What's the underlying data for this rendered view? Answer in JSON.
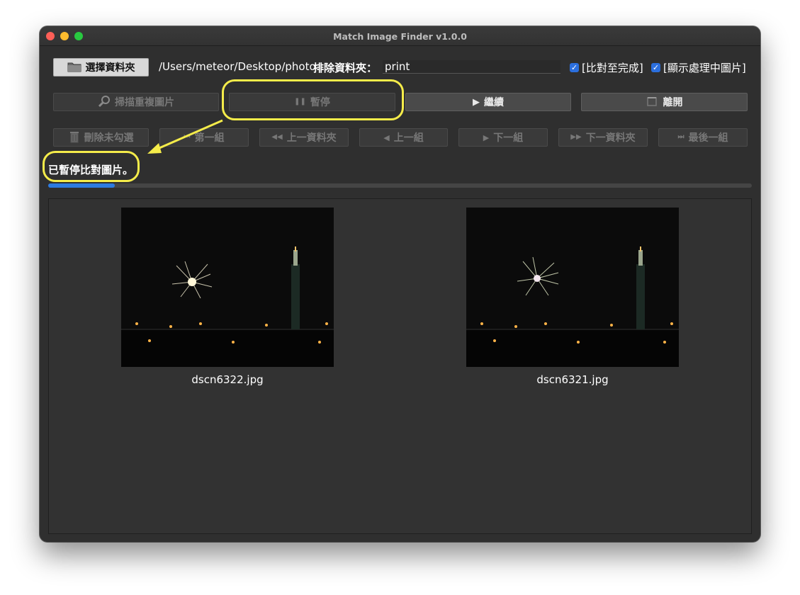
{
  "window": {
    "title": "Match Image Finder v1.0.0"
  },
  "toolbar": {
    "choose_folder_label": "選擇資料夾",
    "folder_path": "/Users/meteor/Desktop/photo",
    "exclude_label": "排除資料夾：",
    "exclude_value": "print",
    "compare_to_complete_label": "[比對至完成]",
    "compare_to_complete_checked": true,
    "show_processing_label": "[顯示處理中圖片]",
    "show_processing_checked": true
  },
  "actions": {
    "scan_label": "掃描重複圖片",
    "pause_label": "暫停",
    "continue_label": "繼續",
    "exit_label": "離開"
  },
  "navigation": {
    "delete_unchecked_label": "刪除未勾選",
    "first_group_label": "第一組",
    "prev_folder_label": "上一資料夾",
    "prev_group_label": "上一組",
    "next_group_label": "下一組",
    "next_folder_label": "下一資料夾",
    "last_group_label": "最後一組"
  },
  "status": {
    "text": "已暫停比對圖片。",
    "progress_fraction": 0.095
  },
  "images": [
    {
      "filename": "dscn6322.jpg"
    },
    {
      "filename": "dscn6321.jpg"
    }
  ],
  "icons": {
    "folder": "folder-icon",
    "scan": "magnifier-icon",
    "pause": "pause-icon",
    "play": "play-icon",
    "exit": "exit-icon",
    "trash": "trash-icon",
    "first": "skip-first-icon",
    "rewind": "rewind-icon",
    "prev": "prev-icon",
    "next": "next-icon",
    "forward": "fast-forward-icon",
    "last": "skip-last-icon"
  },
  "colors": {
    "highlight": "#f5ec4a",
    "progress": "#2d7be0",
    "checkbox": "#2b6fde"
  }
}
